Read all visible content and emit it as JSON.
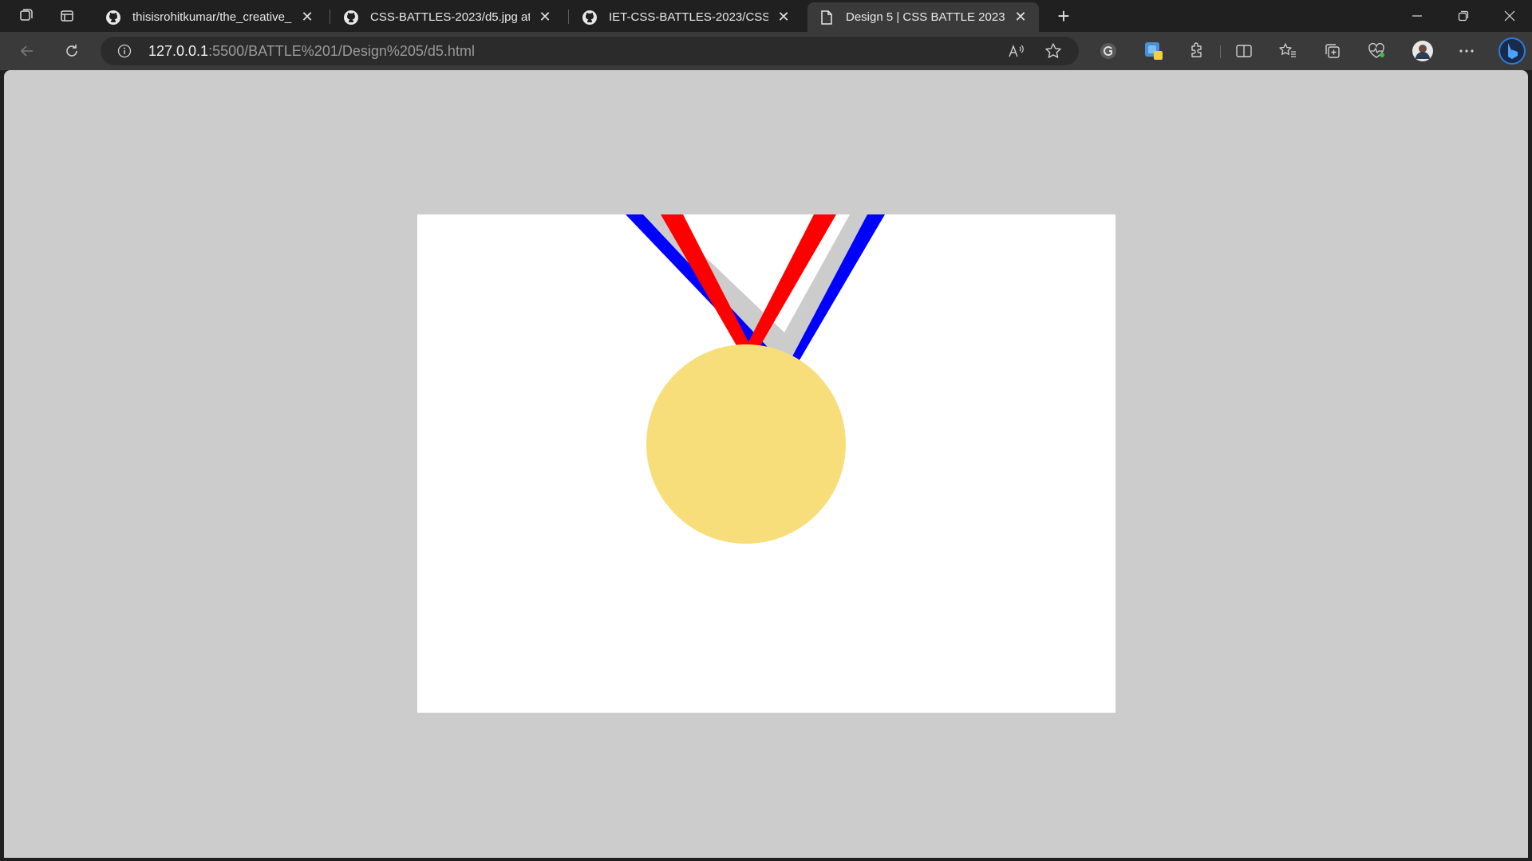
{
  "browser": {
    "tabs": [
      {
        "title": "thisisrohitkumar/the_creative_mi",
        "favicon": "github-icon",
        "active": false
      },
      {
        "title": "CSS-BATTLES-2023/d5.jpg at ma",
        "favicon": "github-icon",
        "active": false
      },
      {
        "title": "IET-CSS-BATTLES-2023/CSS-BAT",
        "favicon": "github-icon",
        "active": false
      },
      {
        "title": "Design 5 | CSS BATTLE 2023",
        "favicon": "page-icon",
        "active": true
      }
    ],
    "url": {
      "host": "127.0.0.1",
      "rest": ":5500/BATTLE%201/Design%205/d5.html"
    }
  },
  "colors": {
    "page_background": "#cccccc",
    "artboard": "#ffffff",
    "medal": "#f8de7b",
    "ribbon_outer": "#0000ff",
    "ribbon_middle": "#cccccc",
    "ribbon_inner": "#ff0000"
  }
}
